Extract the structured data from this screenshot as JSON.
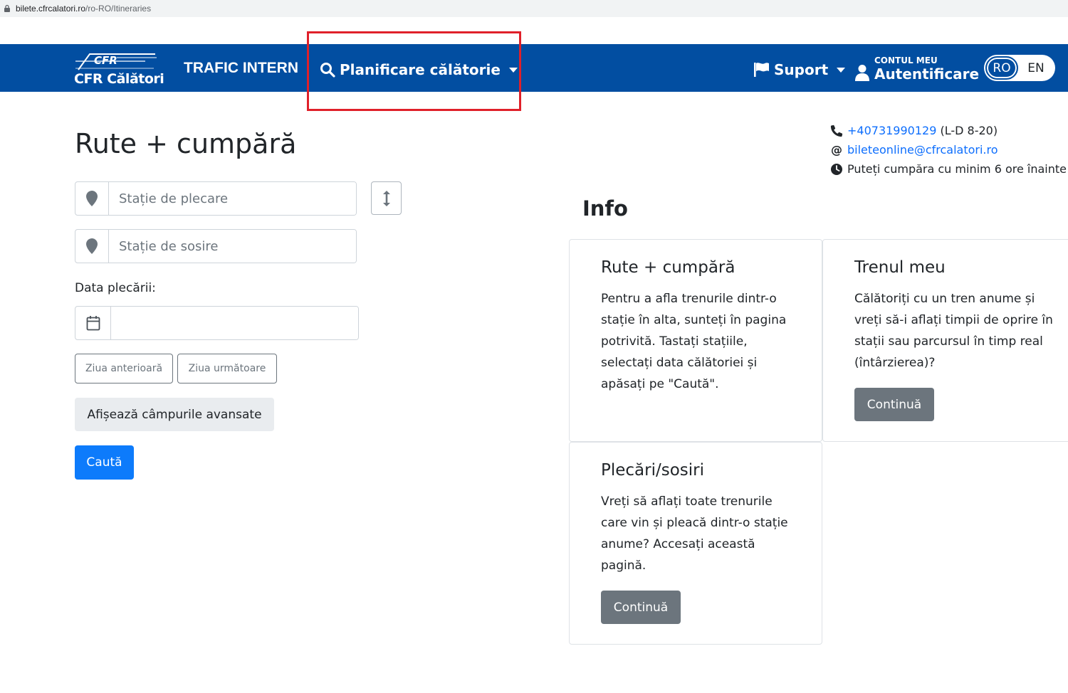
{
  "browser": {
    "url_domain": "bilete.cfrcalatori.ro",
    "url_path": "/ro-RO/Itineraries"
  },
  "navbar": {
    "logo_text": "CFR Călători",
    "trafic_label": "TRAFIC INTERN",
    "plan_label": "Planificare călătorie",
    "support_label": "Suport",
    "account_small": "CONTUL MEU",
    "account_big": "Autentificare",
    "lang_ro": "RO",
    "lang_en": "EN",
    "colors": {
      "bar": "#024ea1",
      "highlight": "#e0202a"
    }
  },
  "contacts": {
    "phone": "+40731990129",
    "phone_hours": "(L-D 8-20)",
    "email": "bileteonline@cfrcalatori.ro",
    "notice": "Puteți cumpăra cu minim 6 ore înainte"
  },
  "form": {
    "title": "Rute + cumpără",
    "from_placeholder": "Stație de plecare",
    "to_placeholder": "Stație de sosire",
    "date_label": "Data plecării:",
    "date_value": "",
    "prev_day": "Ziua anterioară",
    "next_day": "Ziua următoare",
    "advanced": "Afișează câmpurile avansate",
    "search": "Caută"
  },
  "info": {
    "title": "Info",
    "cards": [
      {
        "title": "Rute + cumpără",
        "text": "Pentru a afla trenurile dintr-o stație în alta, sunteți în pagina potrivită. Tastați stațiile, selectați data călătoriei și apăsați pe \"Caută\"."
      },
      {
        "title": "Trenul meu",
        "text": "Călătoriți cu un tren anume și vreți să-i aflați timpii de oprire în stații sau parcursul în timp real (întârzierea)?",
        "button": "Continuă"
      },
      {
        "title": "Plecări/sosiri",
        "text": "Vreți să aflați toate trenurile care vin și pleacă dintr-o stație anume? Accesați această pagină.",
        "button": "Continuă"
      }
    ]
  }
}
